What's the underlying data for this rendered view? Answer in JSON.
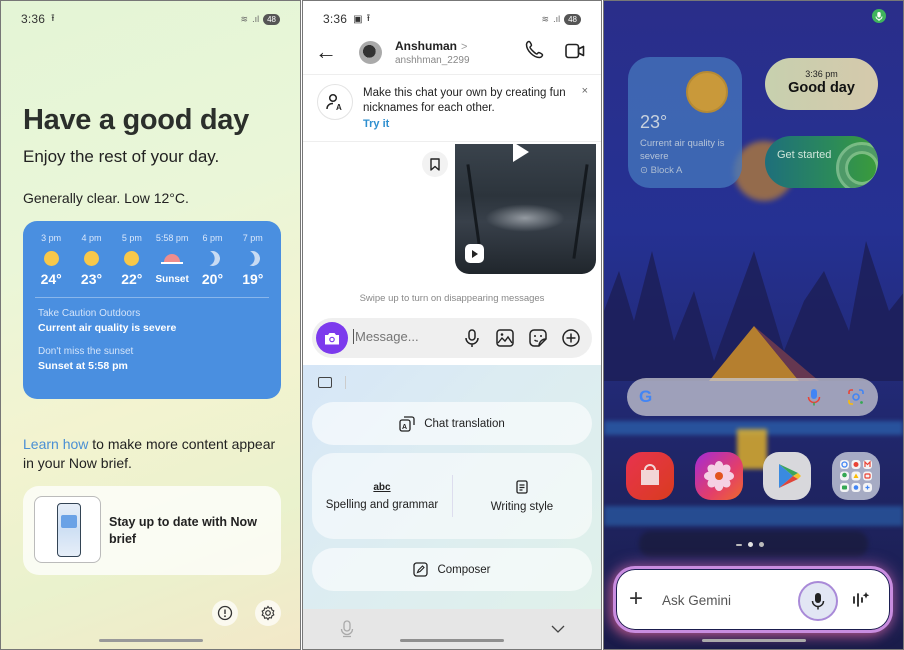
{
  "panels": {
    "now_brief": {
      "status": {
        "time": "3:36",
        "battery": "48"
      },
      "title": "Have a good day",
      "subtitle": "Enjoy the rest of your day.",
      "weather_summary": "Generally clear. Low 12°C.",
      "forecast": [
        {
          "time": "3 pm",
          "icon": "sun-icon",
          "temp": "24°"
        },
        {
          "time": "4 pm",
          "icon": "sun-icon",
          "temp": "23°"
        },
        {
          "time": "5 pm",
          "icon": "sun-icon",
          "temp": "22°"
        },
        {
          "time": "5:58 pm",
          "icon": "sunset-icon",
          "temp": "Sunset"
        },
        {
          "time": "6 pm",
          "icon": "moon-icon",
          "temp": "20°"
        },
        {
          "time": "7 pm",
          "icon": "moon-icon",
          "temp": "19°"
        }
      ],
      "caution_label": "Take Caution Outdoors",
      "caution_value": "Current air quality is severe",
      "sunset_label": "Don't miss the sunset",
      "sunset_value": "Sunset at 5:58 pm",
      "learn_link": "Learn how",
      "learn_rest": " to make more content appear in your Now brief.",
      "promo_card": "Stay up to date with Now brief",
      "info_icon": "!",
      "settings_icon": "⚙"
    },
    "chat": {
      "status": {
        "time": "3:36",
        "battery": "48"
      },
      "contact_name": "Anshuman",
      "contact_chevron": ">",
      "contact_handle": "anshhman_2299",
      "back_icon": "←",
      "nickname_prompt": "Make this chat your own by creating fun nicknames for each other.",
      "nickname_cta": "Try it",
      "close_icon": "×",
      "swipe_hint": "Swipe up to turn on disappearing messages",
      "message_placeholder": "Message...",
      "ai_tools": {
        "chat_translation": "Chat translation",
        "spelling_grammar": "Spelling and grammar",
        "writing_style": "Writing style",
        "composer": "Composer"
      },
      "collapse_icon": "⌄"
    },
    "home": {
      "weather_widget": {
        "temp": "23°",
        "aqi": "Current air quality is severe",
        "location": "Block A"
      },
      "clock_widget": {
        "time": "3:36 pm",
        "greeting": "Good day"
      },
      "health_widget": {
        "label": "Get started"
      },
      "google_logo": "G",
      "apps": [
        "Galaxy Store",
        "Gallery",
        "Play Store",
        "Google folder"
      ],
      "gemini": {
        "plus": "+",
        "placeholder": "Ask Gemini"
      }
    }
  }
}
